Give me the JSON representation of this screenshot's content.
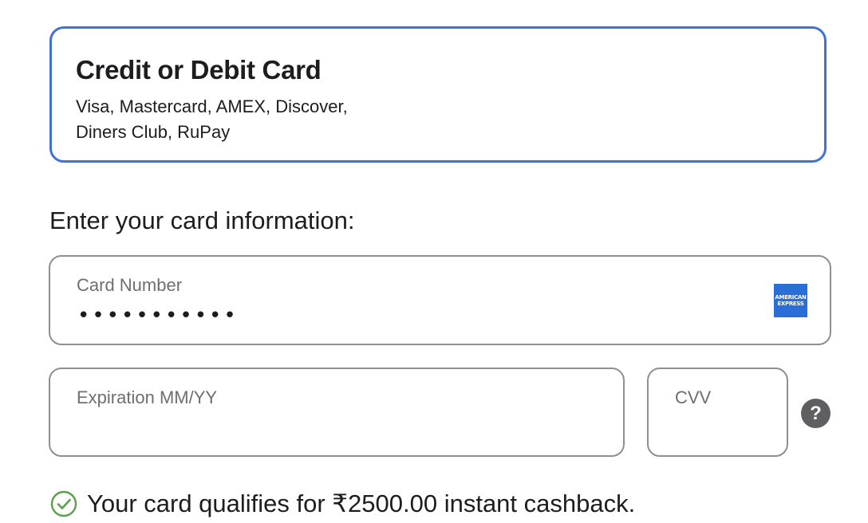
{
  "payment_method": {
    "title": "Credit or Debit Card",
    "description": "Visa, Mastercard, AMEX, Discover, Diners Club, RuPay",
    "border_color": "#3f72d9"
  },
  "section_heading": "Enter your card information:",
  "card_number": {
    "label": "Card Number",
    "value": "•••••••••••",
    "brand_icon": "amex-logo",
    "brand_text_line1": "AMERICAN",
    "brand_text_line2": "EXPRESS"
  },
  "expiration": {
    "label": "Expiration MM/YY",
    "value": ""
  },
  "cvv": {
    "label": "CVV",
    "value": "",
    "help_icon": "question-mark",
    "help_text": "?"
  },
  "cashback": {
    "icon": "check-circle-icon",
    "icon_color": "#5aa04a",
    "message": "Your card qualifies for ₹2500.00 instant cashback."
  }
}
